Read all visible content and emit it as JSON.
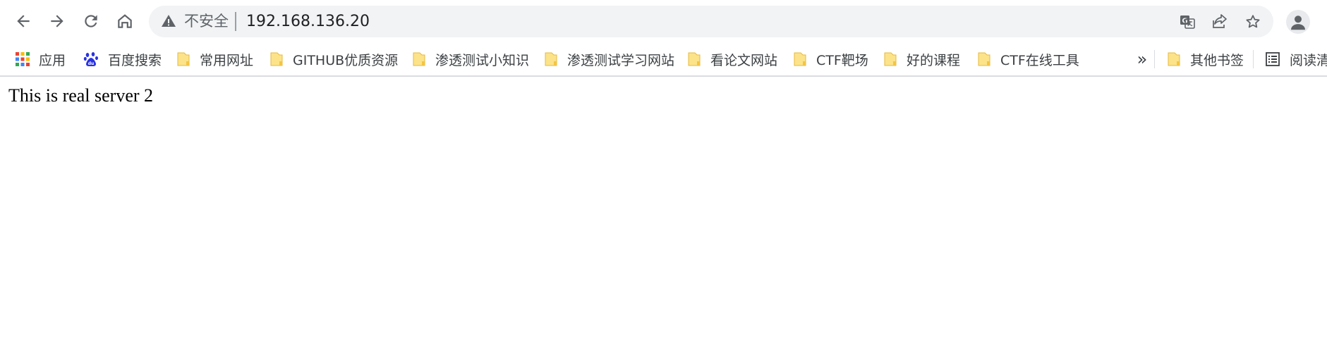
{
  "toolbar": {
    "back_icon": "arrow-left-icon",
    "forward_icon": "arrow-right-icon",
    "reload_icon": "reload-icon",
    "home_icon": "home-icon"
  },
  "omnibox": {
    "security_label": "不安全",
    "url": "192.168.136.20",
    "icons": [
      "warning-icon",
      "translate-icon",
      "share-icon",
      "star-icon"
    ]
  },
  "bookmarks": {
    "apps_label": "应用",
    "baidu_label": "百度搜索",
    "items": [
      {
        "label": "常用网址"
      },
      {
        "label": "GITHUB优质资源"
      },
      {
        "label": "渗透测试小知识"
      },
      {
        "label": "渗透测试学习网站"
      },
      {
        "label": "看论文网站"
      },
      {
        "label": "CTF靶场"
      },
      {
        "label": "好的课程"
      },
      {
        "label": "CTF在线工具"
      }
    ],
    "overflow_label": "»",
    "other_label": "其他书签",
    "reading_list_label": "阅读清"
  },
  "page": {
    "text": "This is real server 2"
  },
  "colors": {
    "omnibox_bg": "#f1f3f4",
    "folder_fill": "#fce38a",
    "folder_edge": "#e6b83c"
  }
}
